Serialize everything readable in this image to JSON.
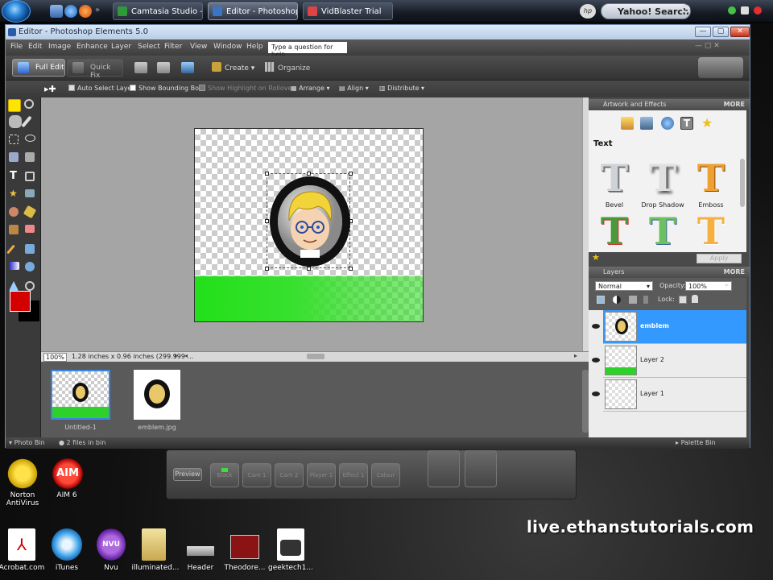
{
  "taskbar": {
    "tasks": [
      {
        "label": "Camtasia Studio - U..."
      },
      {
        "label": "Editor - Photoshop ..."
      },
      {
        "label": "VidBlaster Trial"
      }
    ],
    "search_label": "Yahoo! Search",
    "hp_label": "hp"
  },
  "window": {
    "title": "Editor - Photoshop Elements 5.0",
    "controls": [
      "—",
      "▢",
      "✕"
    ]
  },
  "menubar": {
    "items": [
      "File",
      "Edit",
      "Image",
      "Enhance",
      "Layer",
      "Select",
      "Filter",
      "View",
      "Window",
      "Help"
    ],
    "help_placeholder": "Type a question for help"
  },
  "modebar": {
    "full_edit": "Full Edit",
    "quick_fix": "Quick Fix",
    "create": "Create",
    "organize": "Organize"
  },
  "options": {
    "auto_select": "Auto Select Layer",
    "show_bounding": "Show Bounding Box",
    "show_highlight": "Show Highlight on Rollover",
    "arrange": "Arrange",
    "align": "Align",
    "distribute": "Distribute"
  },
  "colors": {
    "foreground": "#d40000",
    "background": "#000000",
    "accent": "#3399ff",
    "green_layer": "#22e01a"
  },
  "status": {
    "zoom": "100%",
    "doc_info": "1.28 inches x 0.96 inches (299.999 ..."
  },
  "photobin": {
    "items": [
      {
        "label": "Untitled-1"
      },
      {
        "label": "emblem.jpg"
      }
    ],
    "bar_left": "Photo Bin",
    "bar_files": "2 files in bin",
    "bar_right": "Palette Bin"
  },
  "artwork": {
    "header": "Artwork and Effects",
    "more": "MORE",
    "section": "Text",
    "effects": [
      {
        "label": "Bevel"
      },
      {
        "label": "Drop Shadow"
      },
      {
        "label": "Emboss"
      },
      {
        "label": ""
      },
      {
        "label": ""
      },
      {
        "label": ""
      }
    ],
    "apply": "Apply"
  },
  "layers": {
    "header": "Layers",
    "more": "MORE",
    "blend_mode": "Normal",
    "opacity_label": "Opacity:",
    "opacity_value": "100%",
    "lock_label": "Lock:",
    "items": [
      {
        "name": "emblem",
        "selected": true
      },
      {
        "name": "Layer 2",
        "selected": false
      },
      {
        "name": "Layer 1",
        "selected": false
      }
    ]
  },
  "desktop": {
    "panel_preview": "Preview",
    "panel_buttons": [
      "Black",
      "Cam 1",
      "Cam 2",
      "Player 1",
      "Effect 1",
      "Colour"
    ],
    "icons": [
      {
        "label": "Norton AntiVirus"
      },
      {
        "label": "AIM 6"
      },
      {
        "label": "Acrobat.com"
      },
      {
        "label": "iTunes"
      },
      {
        "label": "Nvu"
      },
      {
        "label": "illuminated..."
      },
      {
        "label": "Header"
      },
      {
        "label": "Theodore..."
      },
      {
        "label": "geektech1..."
      }
    ],
    "watermark": "live.ethanstutorials.com"
  }
}
